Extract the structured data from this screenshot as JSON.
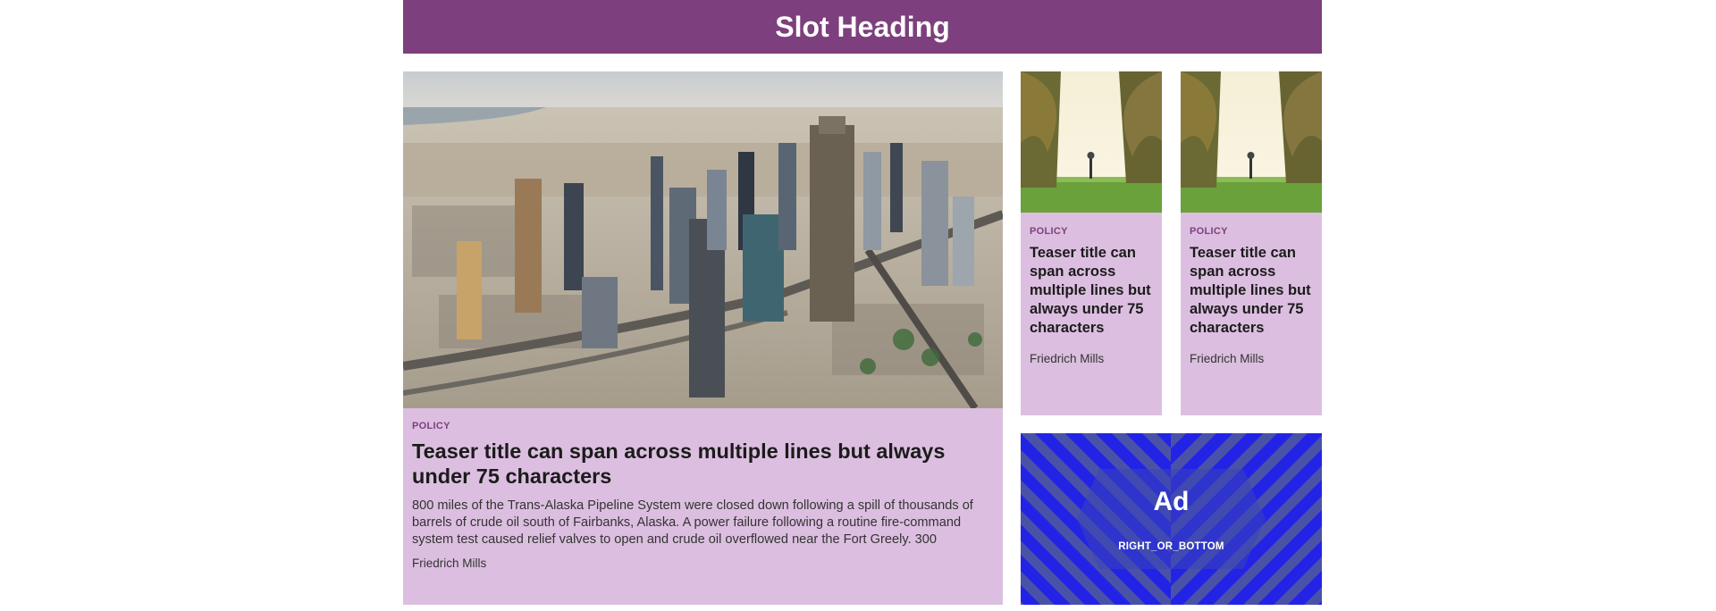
{
  "slot": {
    "heading": "Slot Heading"
  },
  "main_card": {
    "image": "city-skyline-photo",
    "category": "POLICY",
    "title": "Teaser title can span across multiple lines but always under 75 characters",
    "summary": "800 miles of the Trans-Alaska Pipeline System were closed down following a spill of thousands of barrels of crude oil south of Fairbanks, Alaska. A power failure following a routine fire-command system test caused relief valves to open and crude oil overflowed near the Fort Greely. 300",
    "author": "Friedrich Mills"
  },
  "small_cards": [
    {
      "image": "palm-avenue-photo",
      "category": "POLICY",
      "title": "Teaser title can span across multiple lines but always under 75 characters",
      "author": "Friedrich Mills"
    },
    {
      "image": "palm-avenue-photo",
      "category": "POLICY",
      "title": "Teaser title can span across multiple lines but always under 75 characters",
      "author": "Friedrich Mills"
    }
  ],
  "ad": {
    "label": "Ad",
    "position": "RIGHT_OR_BOTTOM"
  },
  "colors": {
    "heading_bg": "#7d3f7d",
    "card_bg": "#dcbfe0",
    "category_text": "#7d3f7d",
    "ad_blue": "#2323e6",
    "ad_stripe": "#4a52a8"
  }
}
